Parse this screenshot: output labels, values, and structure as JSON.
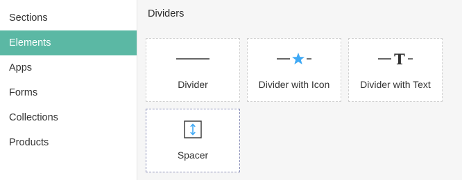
{
  "sidebar": {
    "items": [
      {
        "label": "Sections"
      },
      {
        "label": "Elements",
        "active": true
      },
      {
        "label": "Apps"
      },
      {
        "label": "Forms"
      },
      {
        "label": "Collections"
      },
      {
        "label": "Products"
      }
    ]
  },
  "main": {
    "title": "Dividers",
    "cards": [
      {
        "label": "Divider",
        "icon": "divider-line-icon"
      },
      {
        "label": "Divider with Icon",
        "icon": "divider-star-icon"
      },
      {
        "label": "Divider with Text",
        "icon": "divider-text-icon",
        "icon_letter": "T"
      },
      {
        "label": "Spacer",
        "icon": "spacer-icon",
        "selected": true
      }
    ]
  },
  "colors": {
    "accent": "#5bb8a4",
    "star": "#3fa9f5",
    "selected_border": "#8a8fb8"
  }
}
